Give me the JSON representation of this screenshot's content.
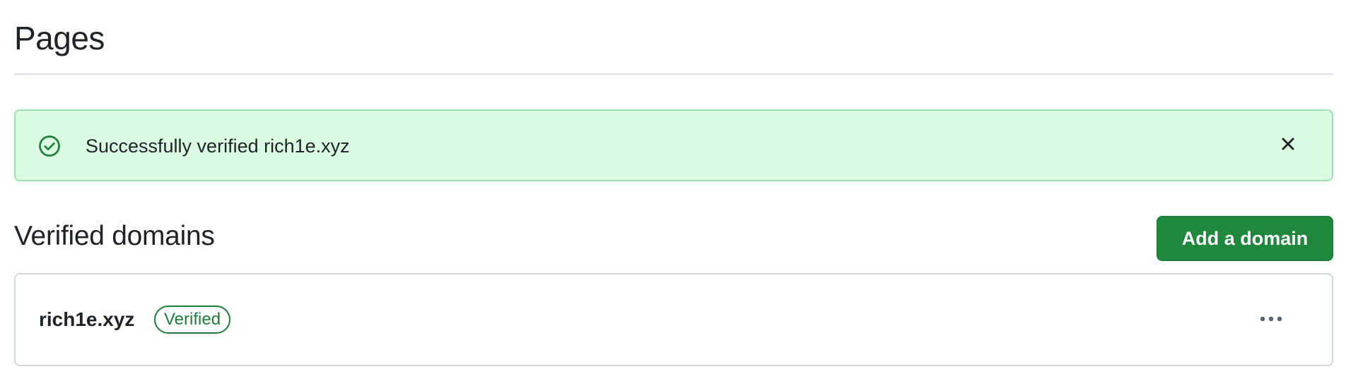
{
  "header": {
    "title": "Pages"
  },
  "flash": {
    "message": "Successfully verified rich1e.xyz",
    "icon": "check-circle-icon",
    "close_icon": "close-icon"
  },
  "verified_domains": {
    "title": "Verified domains",
    "add_button_label": "Add a domain",
    "items": [
      {
        "domain": "rich1e.xyz",
        "status": "Verified",
        "menu_icon": "kebab-horizontal-icon"
      }
    ]
  },
  "colors": {
    "success_bg": "#dafbe1",
    "success_border": "#9ee3ac",
    "success_text": "#1a7f37",
    "primary_button": "#1f883d",
    "text": "#1f2328",
    "border": "#d0d7de"
  }
}
